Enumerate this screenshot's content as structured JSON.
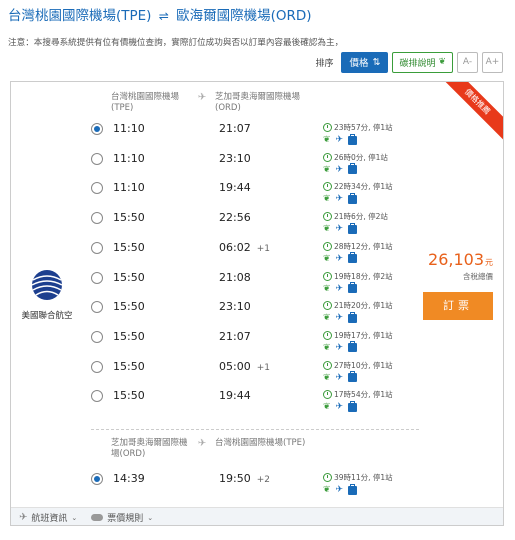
{
  "header": {
    "origin": "台灣桃園國際機場(TPE)",
    "destination": "歐海爾國際機場(ORD)"
  },
  "notice": "注意：本搜尋系統提供有位有價機位查詢，實際訂位成功與否以訂單內容最後確認為主，",
  "sort": {
    "label": "排序",
    "price_label": "價格",
    "env_label": "碳排說明",
    "font_down": "A-",
    "font_up": "A+"
  },
  "ribbon": "價格推薦",
  "airline": {
    "name": "美國聯合航空"
  },
  "outbound": {
    "dep_airport": "台灣桃園國際機場(TPE)",
    "arr_airport": "芝加哥奧海爾國際機場(ORD)",
    "flights": [
      {
        "dep": "11:10",
        "arr": "21:07",
        "plus": "",
        "dur": "23時57分, 停1站",
        "selected": true
      },
      {
        "dep": "11:10",
        "arr": "23:10",
        "plus": "",
        "dur": "26時0分, 停1站",
        "selected": false
      },
      {
        "dep": "11:10",
        "arr": "19:44",
        "plus": "",
        "dur": "22時34分, 停1站",
        "selected": false
      },
      {
        "dep": "15:50",
        "arr": "22:56",
        "plus": "",
        "dur": "21時6分, 停2站",
        "selected": false
      },
      {
        "dep": "15:50",
        "arr": "06:02",
        "plus": "+1",
        "dur": "28時12分, 停1站",
        "selected": false
      },
      {
        "dep": "15:50",
        "arr": "21:08",
        "plus": "",
        "dur": "19時18分, 停2站",
        "selected": false
      },
      {
        "dep": "15:50",
        "arr": "23:10",
        "plus": "",
        "dur": "21時20分, 停1站",
        "selected": false
      },
      {
        "dep": "15:50",
        "arr": "21:07",
        "plus": "",
        "dur": "19時17分, 停1站",
        "selected": false
      },
      {
        "dep": "15:50",
        "arr": "05:00",
        "plus": "+1",
        "dur": "27時10分, 停1站",
        "selected": false
      },
      {
        "dep": "15:50",
        "arr": "19:44",
        "plus": "",
        "dur": "17時54分, 停1站",
        "selected": false
      }
    ]
  },
  "inbound": {
    "dep_airport": "芝加哥奧海爾國際機場(ORD)",
    "arr_airport": "台灣桃園國際機場(TPE)",
    "flights": [
      {
        "dep": "14:39",
        "arr": "19:50",
        "plus": "+2",
        "dur": "39時11分, 停1站",
        "selected": true
      }
    ]
  },
  "price": {
    "amount": "26,103",
    "currency": "元",
    "tax_note": "含稅總價"
  },
  "book_label": "訂票",
  "footer": {
    "flight_info": "航班資訊",
    "fare_rules": "票價規則"
  },
  "colors": {
    "accent": "#1a6bb8",
    "price": "#e8601a",
    "book": "#f08a24",
    "ribbon": "#e8391a",
    "green": "#3b9b3b"
  }
}
